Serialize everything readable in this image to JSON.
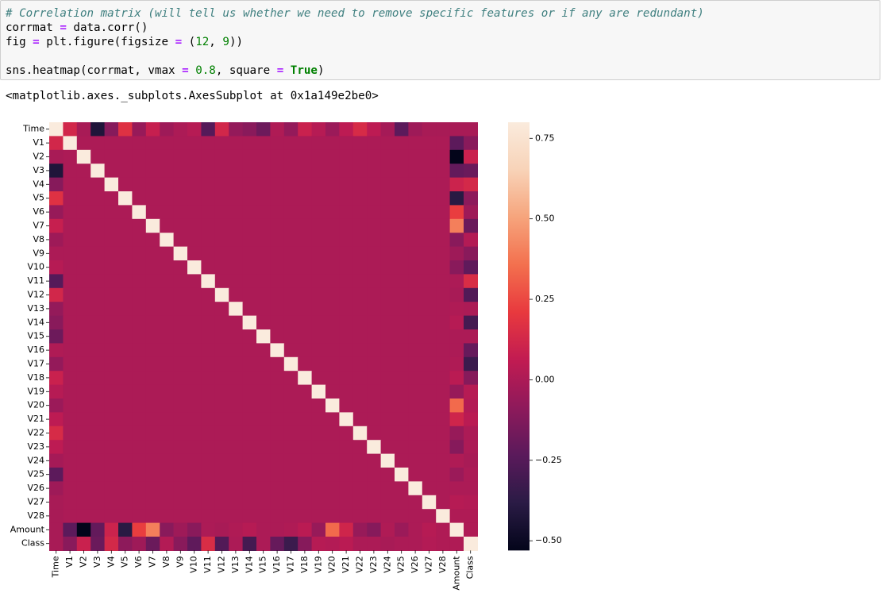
{
  "notebook": {
    "code_lines": [
      [
        {
          "t": "# Correlation matrix (will tell us whether we need to remove specific features or if any are redundant)",
          "c": "comment"
        }
      ],
      [
        {
          "t": "corrmat ",
          "c": ""
        },
        {
          "t": "=",
          "c": "op"
        },
        {
          "t": " data.corr()",
          "c": ""
        }
      ],
      [
        {
          "t": "fig ",
          "c": ""
        },
        {
          "t": "=",
          "c": "op"
        },
        {
          "t": " plt.figure(figsize ",
          "c": ""
        },
        {
          "t": "=",
          "c": "op"
        },
        {
          "t": " (",
          "c": ""
        },
        {
          "t": "12",
          "c": "num"
        },
        {
          "t": ", ",
          "c": ""
        },
        {
          "t": "9",
          "c": "num"
        },
        {
          "t": "))",
          "c": ""
        }
      ],
      [
        {
          "t": "",
          "c": ""
        }
      ],
      [
        {
          "t": "sns.heatmap(corrmat, vmax ",
          "c": ""
        },
        {
          "t": "=",
          "c": "op"
        },
        {
          "t": " ",
          "c": ""
        },
        {
          "t": "0.8",
          "c": "num"
        },
        {
          "t": ", square ",
          "c": ""
        },
        {
          "t": "=",
          "c": "op"
        },
        {
          "t": " ",
          "c": ""
        },
        {
          "t": "True",
          "c": "kw"
        },
        {
          "t": ")",
          "c": ""
        }
      ]
    ],
    "output_text": "<matplotlib.axes._subplots.AxesSubplot at 0x1a149e2be0>"
  },
  "chart_data": {
    "type": "heatmap",
    "variables": [
      "Time",
      "V1",
      "V2",
      "V3",
      "V4",
      "V5",
      "V6",
      "V7",
      "V8",
      "V9",
      "V10",
      "V11",
      "V12",
      "V13",
      "V14",
      "V15",
      "V16",
      "V17",
      "V18",
      "V19",
      "V20",
      "V21",
      "V22",
      "V23",
      "V24",
      "V25",
      "V26",
      "V27",
      "V28",
      "Amount",
      "Class"
    ],
    "time_corr": [
      1.0,
      0.12,
      -0.01,
      -0.42,
      -0.11,
      0.17,
      -0.06,
      0.08,
      -0.04,
      0.0,
      0.03,
      -0.25,
      0.12,
      -0.07,
      -0.1,
      -0.18,
      0.01,
      -0.07,
      0.09,
      0.03,
      -0.05,
      0.05,
      0.14,
      0.05,
      -0.02,
      -0.23,
      -0.04,
      -0.01,
      -0.01,
      -0.01,
      -0.01
    ],
    "amount_corr": [
      -0.01,
      -0.23,
      -0.53,
      -0.21,
      0.1,
      -0.39,
      0.22,
      0.4,
      -0.1,
      -0.04,
      -0.1,
      0.0,
      -0.01,
      0.01,
      0.03,
      -0.0,
      -0.0,
      0.01,
      0.04,
      -0.06,
      0.34,
      0.11,
      -0.06,
      -0.11,
      0.01,
      -0.05,
      -0.0,
      0.03,
      0.01,
      1.0,
      0.01
    ],
    "class_corr": [
      -0.01,
      -0.1,
      0.09,
      -0.19,
      0.13,
      -0.09,
      -0.04,
      -0.19,
      0.02,
      -0.1,
      -0.22,
      0.15,
      -0.26,
      -0.0,
      -0.3,
      -0.0,
      -0.2,
      -0.33,
      -0.11,
      0.03,
      0.02,
      0.04,
      0.0,
      -0.0,
      -0.01,
      0.0,
      0.0,
      0.02,
      0.01,
      0.01,
      1.0
    ],
    "other_corr": 0.0,
    "diagonal": 1.0,
    "vmax": 0.8,
    "vmin": -0.53,
    "colorbar_ticks": [
      "0.75",
      "0.50",
      "0.25",
      "0.00",
      "−0.25",
      "−0.50"
    ],
    "colorbar_tick_values": [
      0.75,
      0.5,
      0.25,
      0.0,
      -0.25,
      -0.5
    ],
    "colormap": "rocket",
    "colormap_stops": [
      "#03051a",
      "#2a1b45",
      "#5a1a5b",
      "#8e1a5b",
      "#c11b52",
      "#e8393e",
      "#f3704e",
      "#f6a47c",
      "#f8d3b8",
      "#faebdd"
    ],
    "grid": false,
    "square": true
  }
}
